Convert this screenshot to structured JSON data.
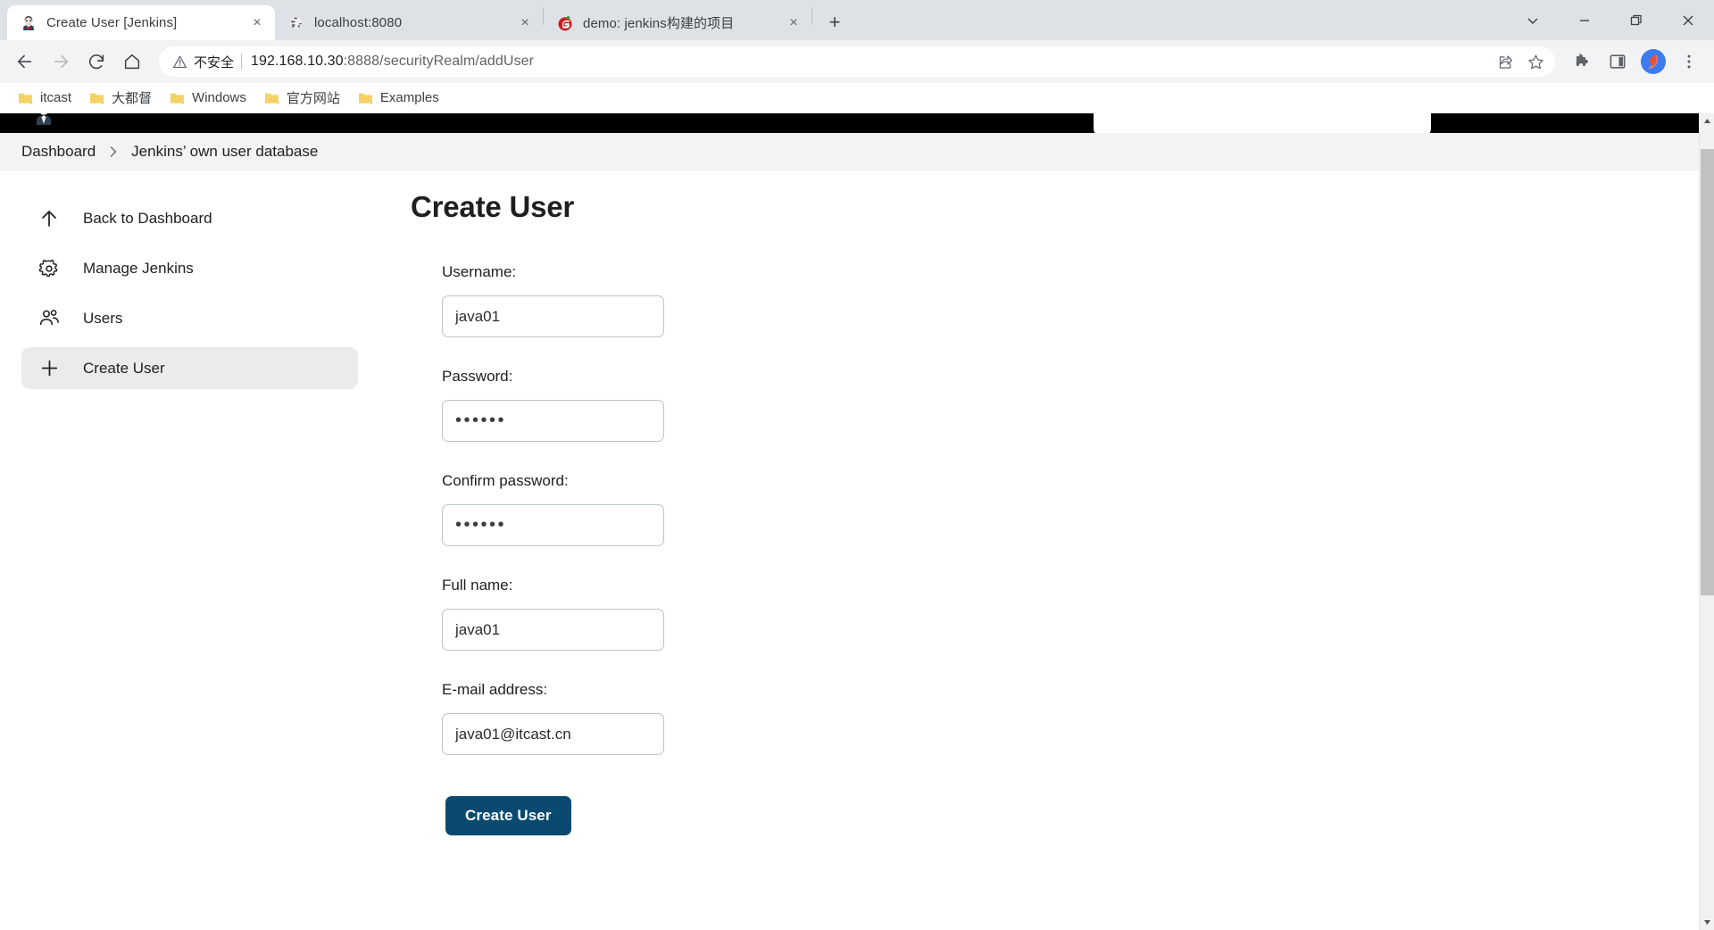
{
  "browser": {
    "tabs": [
      {
        "title": "Create User [Jenkins]",
        "favicon": "jenkins-butler-icon",
        "active": true,
        "close_label": "×"
      },
      {
        "title": "localhost:8080",
        "favicon": "globe-icon",
        "active": false,
        "close_label": "×"
      },
      {
        "title": "demo: jenkins构建的项目",
        "favicon": "gitee-icon",
        "active": false,
        "close_label": "×"
      }
    ],
    "new_tab_label": "+",
    "window_controls": {
      "tab_search_label": "∨",
      "minimize_label": "—",
      "maximize_label": "❐",
      "close_label": "✕"
    },
    "nav": {
      "back_label": "←",
      "forward_label": "→",
      "reload_label": "↻",
      "home_label": "⌂"
    },
    "omnibox": {
      "security_icon": "warning-triangle-icon",
      "security_text": "不安全",
      "url_host": "192.168.10.30",
      "url_rest": ":8888/securityRealm/addUser",
      "url_full": "192.168.10.30:8888/securityRealm/addUser",
      "share_icon": "share-icon",
      "bookmark_icon": "star-icon"
    },
    "toolbar_right": {
      "extensions_icon": "puzzle-piece-icon",
      "sidepanel_icon": "side-panel-icon",
      "profile_icon": "profile-avatar-icon",
      "menu_icon": "three-dot-menu-icon"
    },
    "bookmarks": [
      {
        "label": "itcast",
        "icon": "folder-icon"
      },
      {
        "label": "大都督",
        "icon": "folder-icon"
      },
      {
        "label": "Windows",
        "icon": "folder-icon"
      },
      {
        "label": "官方网站",
        "icon": "folder-icon"
      },
      {
        "label": "Examples",
        "icon": "folder-icon"
      }
    ]
  },
  "page": {
    "header": {
      "logo_icon": "jenkins-logo-icon",
      "search_placeholder": ""
    },
    "breadcrumb": {
      "items": [
        {
          "label": "Dashboard"
        },
        {
          "label": "Jenkins’ own user database"
        }
      ],
      "separator": "›"
    },
    "sidebar": {
      "items": [
        {
          "label": "Back to Dashboard",
          "icon": "arrow-up-icon",
          "active": false
        },
        {
          "label": "Manage Jenkins",
          "icon": "gear-icon",
          "active": false
        },
        {
          "label": "Users",
          "icon": "users-icon",
          "active": false
        },
        {
          "label": "Create User",
          "icon": "plus-icon",
          "active": true
        }
      ]
    },
    "main": {
      "title": "Create User",
      "fields": [
        {
          "label": "Username:",
          "value": "java01",
          "type": "text",
          "name": "username"
        },
        {
          "label": "Password:",
          "value": "••••••",
          "type": "password",
          "name": "password"
        },
        {
          "label": "Confirm password:",
          "value": "••••••",
          "type": "password",
          "name": "confirm-password"
        },
        {
          "label": "Full name:",
          "value": "java01",
          "type": "text",
          "name": "fullname"
        },
        {
          "label": "E-mail address:",
          "value": "java01@itcast.cn",
          "type": "text",
          "name": "email"
        }
      ],
      "submit_label": "Create User"
    },
    "scrollbar": {
      "up_arrow": "▲",
      "down_arrow": "▼"
    }
  },
  "colors": {
    "tabstrip_bg": "#dee1e6",
    "toolbar_bg": "#f1f3f4",
    "jenkins_header_bg": "#000000",
    "breadcrumb_bg": "#f2f3f4",
    "sidebar_active_bg": "#ebebeb",
    "primary_button_bg": "#0b4a70",
    "input_border": "#bcc3c8",
    "text_primary": "#1f1f1f"
  }
}
